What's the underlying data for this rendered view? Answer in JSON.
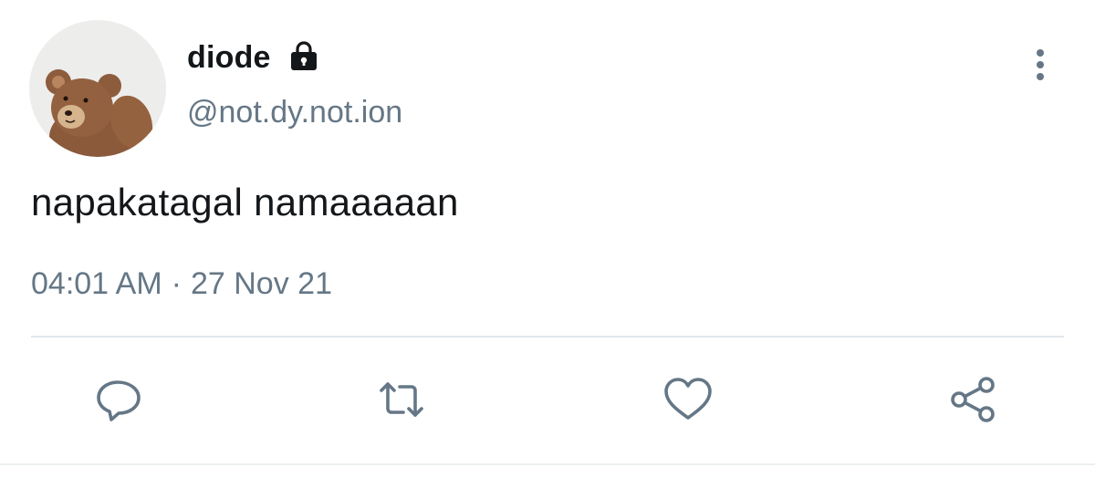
{
  "user": {
    "display_name": "diode",
    "handle": "@not.dy.not.ion",
    "protected_icon": "lock-icon",
    "avatar": "teddy-bear-avatar"
  },
  "tweet": {
    "text": "napakatagal namaaaaan",
    "time": "04:01 AM",
    "separator": "·",
    "date": "27 Nov 21"
  },
  "actions": {
    "reply_icon": "comment-icon",
    "retweet_icon": "retweet-icon",
    "like_icon": "heart-icon",
    "share_icon": "share-icon",
    "more_icon": "more-vertical-icon"
  },
  "colors": {
    "text": "#14171a",
    "secondary": "#657786",
    "divider": "#e1e8ed"
  }
}
